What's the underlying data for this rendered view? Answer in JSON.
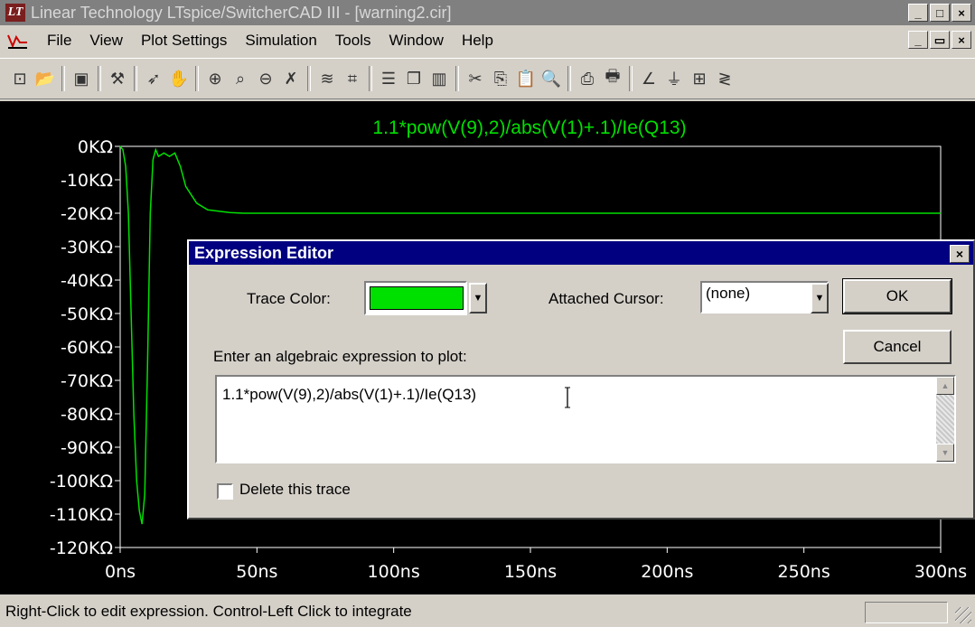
{
  "window": {
    "title": "Linear Technology LTspice/SwitcherCAD III - [warning2.cir]",
    "caption_buttons": [
      "_",
      "□",
      "×"
    ],
    "mdi_buttons": [
      "_",
      "▭",
      "×"
    ]
  },
  "menu": {
    "items": [
      {
        "label": "File"
      },
      {
        "label": "View"
      },
      {
        "label": "Plot Settings"
      },
      {
        "label": "Simulation"
      },
      {
        "label": "Tools"
      },
      {
        "label": "Window"
      },
      {
        "label": "Help"
      }
    ]
  },
  "toolbar": {
    "buttons": [
      "open-schematic-icon",
      "open-folder-icon",
      "|",
      "save-icon",
      "|",
      "hammer-icon",
      "|",
      "run-icon",
      "pan-hand-icon",
      "|",
      "zoom-in-icon",
      "zoom-area-icon",
      "zoom-out-icon",
      "cancel-zoom-icon",
      "|",
      "autorange-icon",
      "mark-icon",
      "|",
      "tile-horizontal-icon",
      "cascade-icon",
      "tile-vertical-icon",
      "|",
      "cut-icon",
      "copy-icon",
      "paste-icon",
      "find-icon",
      "|",
      "print-preview-icon",
      "print-icon",
      "|",
      "draw-wire-icon",
      "ground-icon",
      "component-icon",
      "resistor-icon"
    ]
  },
  "plot": {
    "trace_label": "1.1*pow(V(9),2)/abs(V(1)+.1)/Ie(Q13)",
    "trace_color": "#00e000"
  },
  "chart_data": {
    "type": "line",
    "title": "1.1*pow(V(9),2)/abs(V(1)+.1)/Ie(Q13)",
    "xlabel": "",
    "ylabel": "",
    "xlim": [
      0,
      300
    ],
    "ylim": [
      -120,
      0
    ],
    "x_ticks": [
      "0ns",
      "50ns",
      "100ns",
      "150ns",
      "200ns",
      "250ns",
      "300ns"
    ],
    "y_ticks": [
      "0KΩ",
      "-10KΩ",
      "-20KΩ",
      "-30KΩ",
      "-40KΩ",
      "-50KΩ",
      "-60KΩ",
      "-70KΩ",
      "-80KΩ",
      "-90KΩ",
      "-100KΩ",
      "-110KΩ",
      "-120KΩ"
    ],
    "series": [
      {
        "color": "#00e000",
        "x": [
          0,
          1,
          2,
          3,
          4,
          5,
          6,
          7,
          8,
          9,
          10,
          11,
          12,
          13,
          14,
          16,
          18,
          20,
          22,
          24,
          28,
          32,
          40,
          45,
          50,
          60,
          80,
          100,
          150,
          200,
          250,
          300
        ],
        "y": [
          0,
          -1,
          -6,
          -20,
          -50,
          -80,
          -100,
          -109,
          -113,
          -104,
          -65,
          -20,
          -4,
          -1,
          -3,
          -2,
          -3,
          -2,
          -6,
          -12,
          -17,
          -19,
          -19.8,
          -20,
          -20,
          -20,
          -20,
          -20,
          -20,
          -20,
          -20,
          -20
        ]
      }
    ]
  },
  "dialog": {
    "title": "Expression Editor",
    "close_label": "×",
    "trace_color_label": "Trace Color:",
    "attached_cursor_label": "Attached Cursor:",
    "attached_cursor_value": "(none)",
    "ok_label": "OK",
    "cancel_label": "Cancel",
    "prompt_label": "Enter an algebraic expression to plot:",
    "expression_value": "1.1*pow(V(9),2)/abs(V(1)+.1)/Ie(Q13)",
    "delete_trace_label": "Delete this trace",
    "delete_trace_checked": false
  },
  "status": {
    "text": "Right-Click to edit expression. Control-Left Click to integrate"
  }
}
